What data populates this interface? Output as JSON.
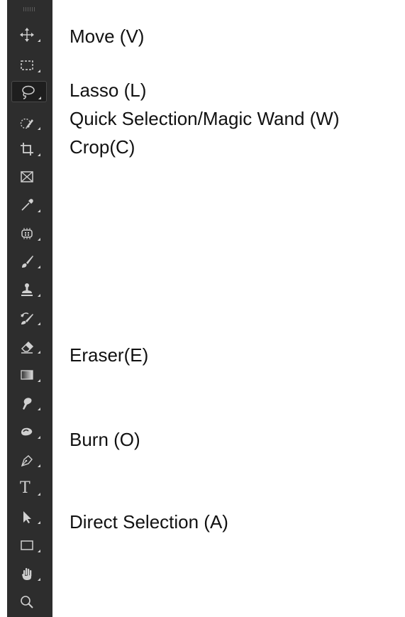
{
  "toolbar": {
    "tools": [
      {
        "icon": "move-icon"
      },
      {
        "icon": "rectangular-marquee-icon"
      },
      {
        "icon": "lasso-icon",
        "selected": true
      },
      {
        "icon": "quick-selection-icon"
      },
      {
        "icon": "crop-icon"
      },
      {
        "icon": "frame-icon"
      },
      {
        "icon": "eyedropper-icon"
      },
      {
        "icon": "spot-healing-icon"
      },
      {
        "icon": "brush-icon"
      },
      {
        "icon": "clone-stamp-icon"
      },
      {
        "icon": "history-brush-icon"
      },
      {
        "icon": "eraser-icon"
      },
      {
        "icon": "gradient-icon"
      },
      {
        "icon": "blur-icon"
      },
      {
        "icon": "burn-icon"
      },
      {
        "icon": "pen-icon"
      },
      {
        "icon": "type-icon"
      },
      {
        "icon": "direct-selection-icon"
      },
      {
        "icon": "rectangle-shape-icon"
      },
      {
        "icon": "hand-icon"
      },
      {
        "icon": "zoom-icon"
      }
    ],
    "type_glyph": "T"
  },
  "labels": {
    "move": "Move (V)",
    "lasso": "Lasso (L)",
    "quick_selection": "Quick Selection/Magic Wand (W)",
    "crop": "Crop(C)",
    "eraser": "Eraser(E)",
    "burn": "Burn (O)",
    "direct_selection": "Direct Selection (A)"
  }
}
